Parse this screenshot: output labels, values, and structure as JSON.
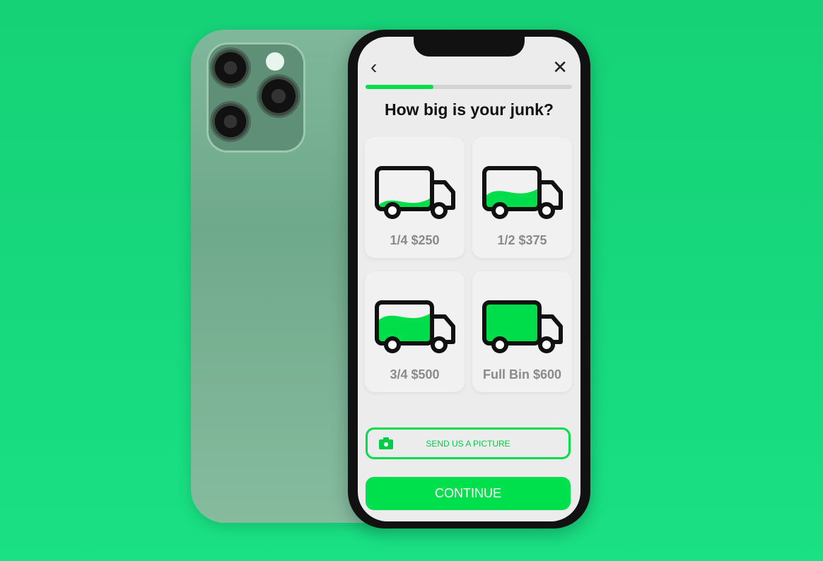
{
  "header": {
    "title": "How big is your junk?",
    "progress": 0.33
  },
  "options": [
    {
      "label": "1/4 $250",
      "fill": 0.25
    },
    {
      "label": "1/2 $375",
      "fill": 0.5
    },
    {
      "label": "3/4 $500",
      "fill": 0.75
    },
    {
      "label": "Full Bin $600",
      "fill": 1
    }
  ],
  "actions": {
    "send_picture": "SEND US A PICTURE",
    "continue": "CONTINUE"
  },
  "colors": {
    "accent": "#00dd4a",
    "background": "#17d77b"
  }
}
